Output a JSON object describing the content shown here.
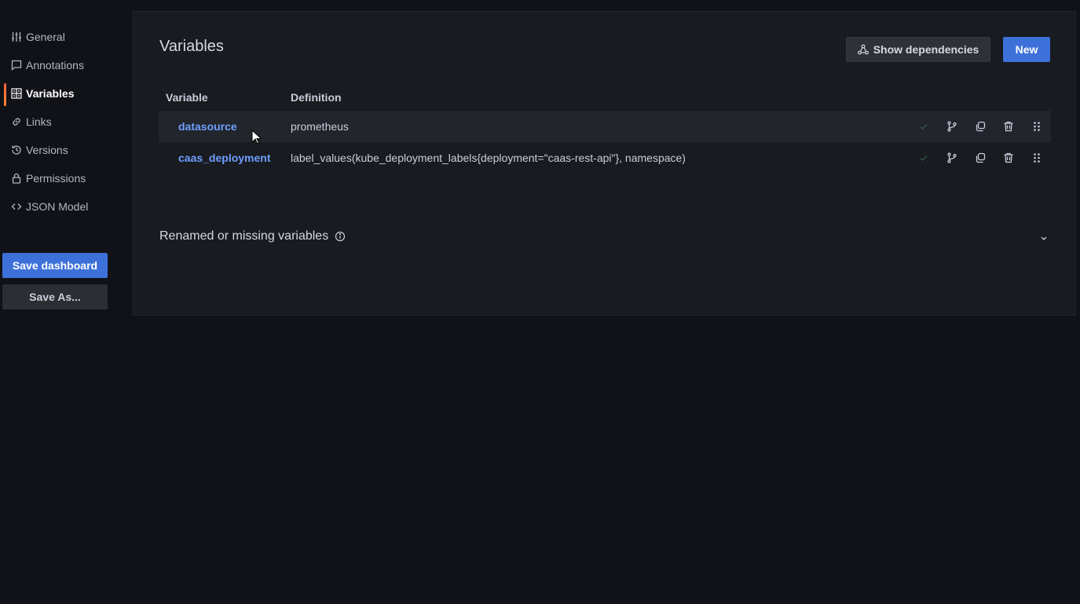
{
  "sidebar": {
    "items": [
      {
        "label": "General",
        "icon": "sliders-icon"
      },
      {
        "label": "Annotations",
        "icon": "comment-icon"
      },
      {
        "label": "Variables",
        "icon": "variables-icon",
        "active": true
      },
      {
        "label": "Links",
        "icon": "link-icon"
      },
      {
        "label": "Versions",
        "icon": "history-icon"
      },
      {
        "label": "Permissions",
        "icon": "lock-icon"
      },
      {
        "label": "JSON Model",
        "icon": "code-icon"
      }
    ],
    "save_label": "Save dashboard",
    "save_as_label": "Save As..."
  },
  "main": {
    "title": "Variables",
    "show_dependencies_label": "Show dependencies",
    "new_label": "New",
    "table": {
      "headers": [
        "Variable",
        "Definition"
      ],
      "rows": [
        {
          "name": "datasource",
          "definition": "prometheus"
        },
        {
          "name": "caas_deployment",
          "definition": "label_values(kube_deployment_labels{deployment=\"caas-rest-api\"}, namespace)"
        }
      ]
    },
    "renamed_label": "Renamed or missing variables"
  },
  "colors": {
    "background": "#111217",
    "panel": "#181b1f",
    "primary": "#3d71d9",
    "link": "#6e9fff",
    "active_accent": "#f55f3e"
  }
}
